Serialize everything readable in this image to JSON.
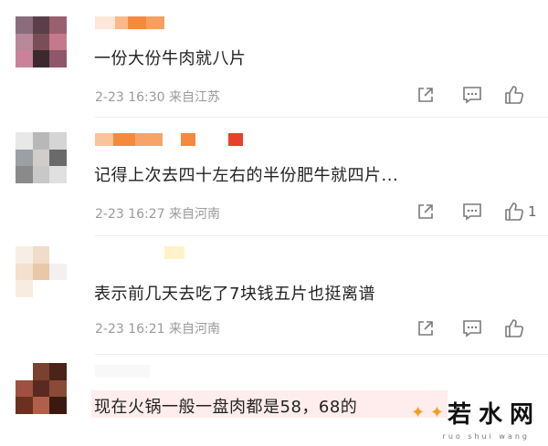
{
  "comments": [
    {
      "text": "一份大份牛肉就八片",
      "meta": "2-23 16:30 来自江苏",
      "like_count": ""
    },
    {
      "text": "记得上次去四十左右的半份肥牛就四片...",
      "meta": "2-23 16:27 来自河南",
      "like_count": "1"
    },
    {
      "text": "表示前几天去吃了7块钱五片也挺离谱",
      "meta": "2-23 16:21 来自河南",
      "like_count": ""
    },
    {
      "text": "现在火锅一般一盘肉都是58，68的",
      "meta": "",
      "like_count": ""
    }
  ],
  "watermark": {
    "text": "若水网",
    "subtext": "ruo shui wang"
  },
  "colors": {
    "text": "#222222",
    "meta": "#9a9a9a",
    "icon": "#7a7a7a",
    "name_blur_orange": "#f58a3c",
    "name_blur_red": "#e8402a"
  },
  "icons": [
    "share-icon",
    "comment-icon",
    "like-icon"
  ]
}
